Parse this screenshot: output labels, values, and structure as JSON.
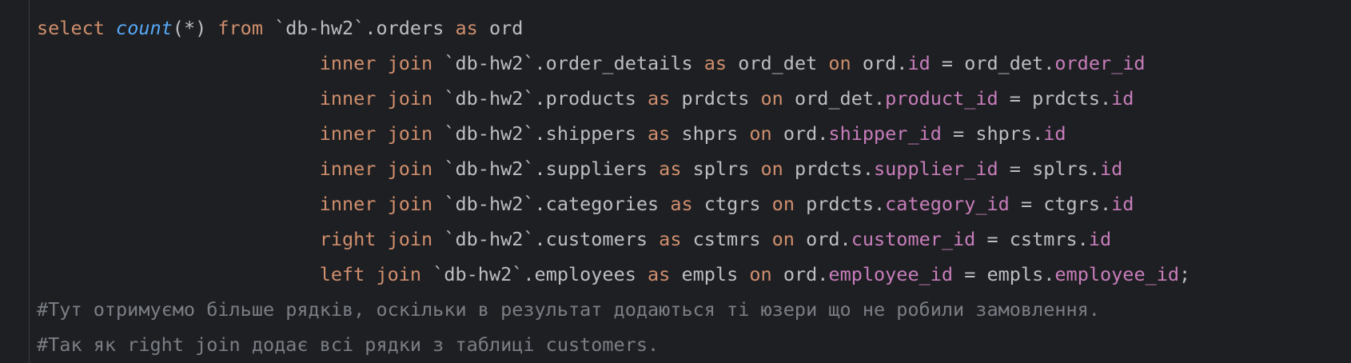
{
  "editor": {
    "lines": [
      [
        {
          "t": "select",
          "c": "kw"
        },
        {
          "t": " ",
          "c": "id"
        },
        {
          "t": "count",
          "c": "fn"
        },
        {
          "t": "(*) ",
          "c": "id"
        },
        {
          "t": "from",
          "c": "kw"
        },
        {
          "t": " `db-hw2`.orders ",
          "c": "id"
        },
        {
          "t": "as",
          "c": "kw"
        },
        {
          "t": " ord",
          "c": "id"
        }
      ],
      [
        {
          "t": "                         ",
          "c": "id"
        },
        {
          "t": "inner join",
          "c": "kw"
        },
        {
          "t": " `db-hw2`.order_details ",
          "c": "id"
        },
        {
          "t": "as",
          "c": "kw"
        },
        {
          "t": " ord_det ",
          "c": "id"
        },
        {
          "t": "on",
          "c": "kw"
        },
        {
          "t": " ord.",
          "c": "id"
        },
        {
          "t": "id",
          "c": "field"
        },
        {
          "t": " = ord_det.",
          "c": "id"
        },
        {
          "t": "order_id",
          "c": "field"
        }
      ],
      [
        {
          "t": "                         ",
          "c": "id"
        },
        {
          "t": "inner join",
          "c": "kw"
        },
        {
          "t": " `db-hw2`.products ",
          "c": "id"
        },
        {
          "t": "as",
          "c": "kw"
        },
        {
          "t": " prdcts ",
          "c": "id"
        },
        {
          "t": "on",
          "c": "kw"
        },
        {
          "t": " ord_det.",
          "c": "id"
        },
        {
          "t": "product_id",
          "c": "field"
        },
        {
          "t": " = prdcts.",
          "c": "id"
        },
        {
          "t": "id",
          "c": "field"
        }
      ],
      [
        {
          "t": "                         ",
          "c": "id"
        },
        {
          "t": "inner join",
          "c": "kw"
        },
        {
          "t": " `db-hw2`.shippers ",
          "c": "id"
        },
        {
          "t": "as",
          "c": "kw"
        },
        {
          "t": " shprs ",
          "c": "id"
        },
        {
          "t": "on",
          "c": "kw"
        },
        {
          "t": " ord.",
          "c": "id"
        },
        {
          "t": "shipper_id",
          "c": "field"
        },
        {
          "t": " = shprs.",
          "c": "id"
        },
        {
          "t": "id",
          "c": "field"
        }
      ],
      [
        {
          "t": "                         ",
          "c": "id"
        },
        {
          "t": "inner join",
          "c": "kw"
        },
        {
          "t": " `db-hw2`.suppliers ",
          "c": "id"
        },
        {
          "t": "as",
          "c": "kw"
        },
        {
          "t": " splrs ",
          "c": "id"
        },
        {
          "t": "on",
          "c": "kw"
        },
        {
          "t": " prdcts.",
          "c": "id"
        },
        {
          "t": "supplier_id",
          "c": "field"
        },
        {
          "t": " = splrs.",
          "c": "id"
        },
        {
          "t": "id",
          "c": "field"
        }
      ],
      [
        {
          "t": "                         ",
          "c": "id"
        },
        {
          "t": "inner join",
          "c": "kw"
        },
        {
          "t": " `db-hw2`.categories ",
          "c": "id"
        },
        {
          "t": "as",
          "c": "kw"
        },
        {
          "t": " ctgrs ",
          "c": "id"
        },
        {
          "t": "on",
          "c": "kw"
        },
        {
          "t": " prdcts.",
          "c": "id"
        },
        {
          "t": "category_id",
          "c": "field"
        },
        {
          "t": " = ctgrs.",
          "c": "id"
        },
        {
          "t": "id",
          "c": "field"
        }
      ],
      [
        {
          "t": "                         ",
          "c": "id"
        },
        {
          "t": "right join",
          "c": "kw"
        },
        {
          "t": " `db-hw2`.customers ",
          "c": "id"
        },
        {
          "t": "as",
          "c": "kw"
        },
        {
          "t": " cstmrs ",
          "c": "id"
        },
        {
          "t": "on",
          "c": "kw"
        },
        {
          "t": " ord.",
          "c": "id"
        },
        {
          "t": "customer_id",
          "c": "field"
        },
        {
          "t": " = cstmrs.",
          "c": "id"
        },
        {
          "t": "id",
          "c": "field"
        }
      ],
      [
        {
          "t": "                         ",
          "c": "id"
        },
        {
          "t": "left join",
          "c": "kw"
        },
        {
          "t": " `db-hw2`.employees ",
          "c": "id"
        },
        {
          "t": "as",
          "c": "kw"
        },
        {
          "t": " empls ",
          "c": "id"
        },
        {
          "t": "on",
          "c": "kw"
        },
        {
          "t": " ord.",
          "c": "id"
        },
        {
          "t": "employee_id",
          "c": "field"
        },
        {
          "t": " = empls.",
          "c": "id"
        },
        {
          "t": "employee_id",
          "c": "field"
        },
        {
          "t": ";",
          "c": "id"
        }
      ],
      [
        {
          "t": "#Тут отримуємо більше рядків, оскільки в результат додаються ті юзери що не робили замовлення.",
          "c": "cmt"
        }
      ],
      [
        {
          "t": "#Так як right join додає всі рядки з таблиці customers.",
          "c": "cmt"
        }
      ]
    ]
  },
  "colors": {
    "background": "#1e1f22",
    "keyword": "#cf8e6d",
    "function": "#56a8f5",
    "field": "#c77dbb",
    "identifier": "#bcbec4",
    "comment": "#7a7e85"
  }
}
